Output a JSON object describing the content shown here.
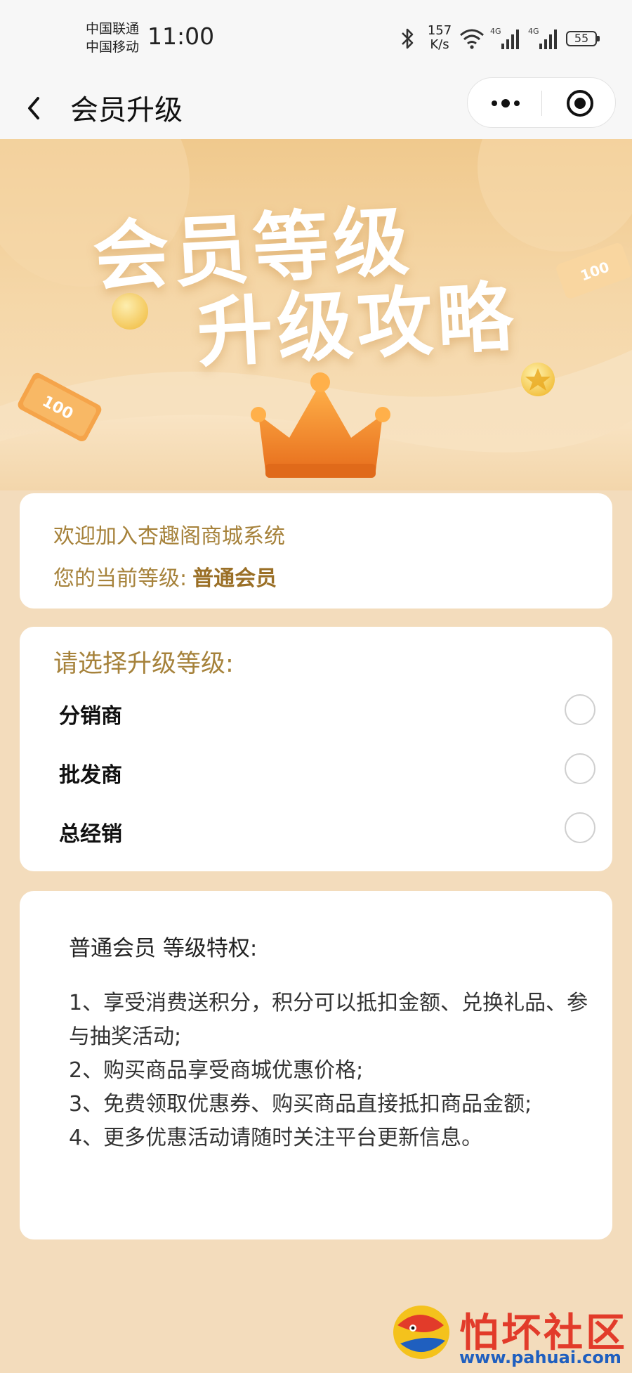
{
  "status_bar": {
    "carrier_1": "中国联通",
    "carrier_2": "中国移动",
    "time": "11:00",
    "speed_value": "157",
    "speed_unit": "K/s",
    "network_1": "4G",
    "network_2": "4G",
    "battery": "55"
  },
  "nav": {
    "title": "会员升级"
  },
  "banner": {
    "line1": "会员等级",
    "line2": "升级攻略",
    "bill_label": "100"
  },
  "welcome": {
    "greeting": "欢迎加入杏趣阁商城系统",
    "level_label": "您的当前等级:",
    "level_value": "普通会员"
  },
  "upgrade": {
    "title": "请选择升级等级:",
    "options": [
      {
        "label": "分销商",
        "selected": false
      },
      {
        "label": "批发商",
        "selected": false
      },
      {
        "label": "总经销",
        "selected": false
      }
    ]
  },
  "privileges": {
    "title": "普通会员 等级特权:",
    "items": [
      "1、享受消费送积分，积分可以抵扣金额、兑换礼品、参与抽奖活动;",
      "2、购买商品享受商城优惠价格;",
      "3、免费领取优惠券、购买商品直接抵扣商品金额;",
      "4、更多优惠活动请随时关注平台更新信息。"
    ]
  },
  "watermark": {
    "text": "怕坏社区",
    "url": "www.pahuai.com"
  },
  "colors": {
    "gold_text": "#a6823b",
    "banner_bg": "#f0c98d",
    "page_bg": "#f3dcbc",
    "crown": "#f08a2a"
  }
}
